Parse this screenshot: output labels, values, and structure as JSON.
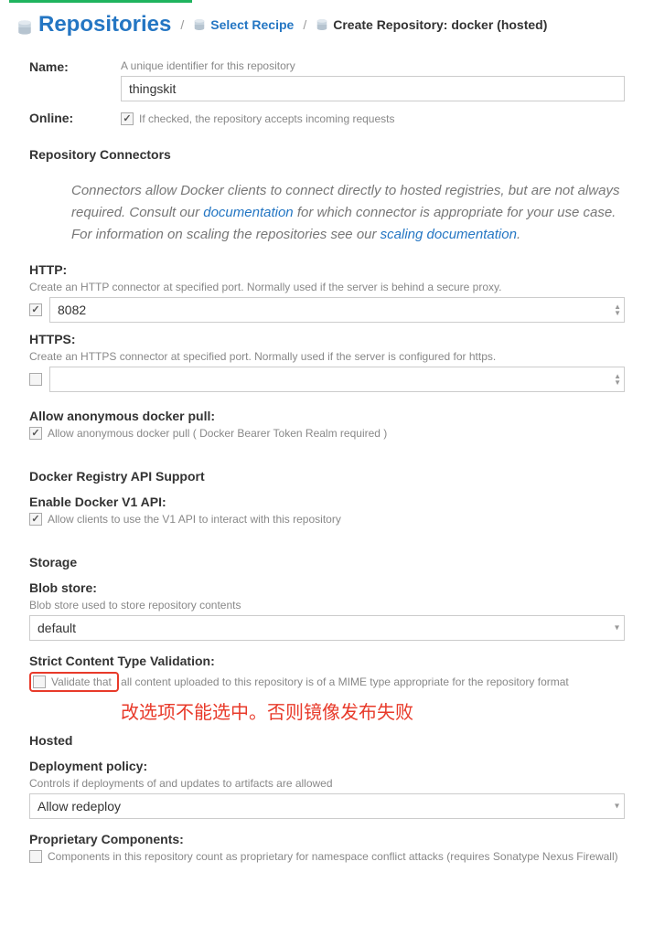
{
  "breadcrumb": {
    "root": "Repositories",
    "select": "Select Recipe",
    "create": "Create Repository: docker (hosted)"
  },
  "name": {
    "label": "Name:",
    "help": "A unique identifier for this repository",
    "value": "thingskit"
  },
  "online": {
    "label": "Online:",
    "help": "If checked, the repository accepts incoming requests"
  },
  "connectors": {
    "title": "Repository Connectors",
    "desc1": "Connectors allow Docker clients to connect directly to hosted registries, but are not always required. Consult our ",
    "link1": "documentation",
    "desc2": " for which connector is appropriate for your use case. For information on scaling the repositories see our ",
    "link2": "scaling documentation",
    "desc3": ".",
    "http": {
      "label": "HTTP:",
      "help": "Create an HTTP connector at specified port. Normally used if the server is behind a secure proxy.",
      "value": "8082"
    },
    "https": {
      "label": "HTTPS:",
      "help": "Create an HTTPS connector at specified port. Normally used if the server is configured for https."
    }
  },
  "anon": {
    "label": "Allow anonymous docker pull:",
    "cb": "Allow anonymous docker pull ( Docker Bearer Token Realm required )"
  },
  "api": {
    "title": "Docker Registry API Support",
    "label": "Enable Docker V1 API:",
    "cb": "Allow clients to use the V1 API to interact with this repository"
  },
  "storage": {
    "title": "Storage",
    "blob": {
      "label": "Blob store:",
      "help": "Blob store used to store repository contents",
      "value": "default"
    },
    "strict": {
      "label": "Strict Content Type Validation:",
      "cb": "Validate that all content uploaded to this repository is of a MIME type appropriate for the repository format"
    }
  },
  "annotation": "改选项不能选中。否则镜像发布失败",
  "hosted": {
    "title": "Hosted",
    "deploy": {
      "label": "Deployment policy:",
      "help": "Controls if deployments of and updates to artifacts are allowed",
      "value": "Allow redeploy"
    },
    "prop": {
      "label": "Proprietary Components:",
      "cb": "Components in this repository count as proprietary for namespace conflict attacks (requires Sonatype Nexus Firewall)"
    }
  }
}
